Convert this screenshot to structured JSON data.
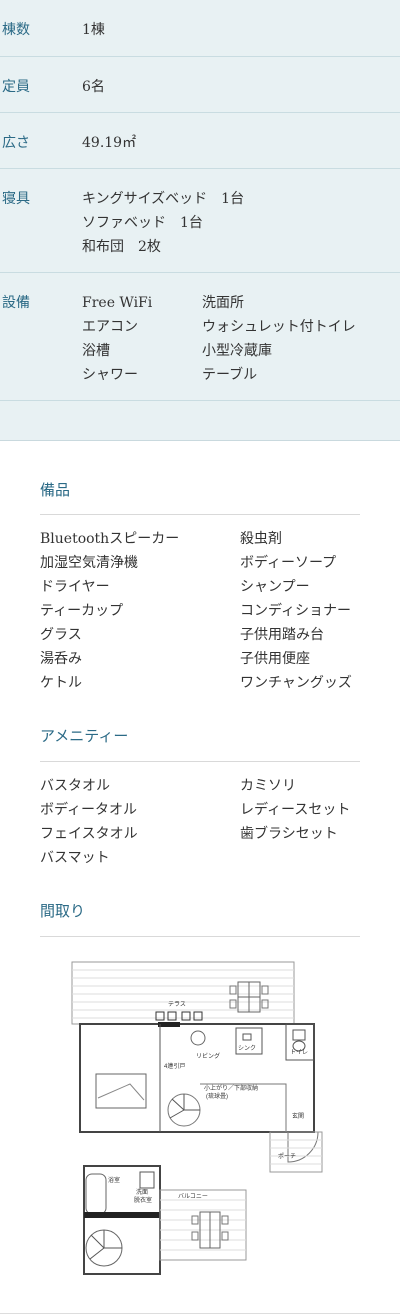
{
  "specs": {
    "buildings": {
      "label": "棟数",
      "value": "1棟"
    },
    "capacity": {
      "label": "定員",
      "value": "6名"
    },
    "area": {
      "label": "広さ",
      "value": "49.19㎡"
    },
    "bedding": {
      "label": "寝具",
      "lines": [
        "キングサイズベッド　1台",
        "ソファベッド　1台",
        "和布団　2枚"
      ]
    },
    "facilities": {
      "label": "設備",
      "col1": [
        "Free WiFi",
        "エアコン",
        "浴槽",
        "シャワー"
      ],
      "col2": [
        "洗面所",
        "ウォシュレット付トイレ",
        "小型冷蔵庫",
        "テーブル"
      ]
    }
  },
  "equipment": {
    "title": "備品",
    "col1": [
      "Bluetoothスピーカー",
      "加湿空気清浄機",
      "ドライヤー",
      "ティーカップ",
      "グラス",
      "湯呑み",
      "ケトル"
    ],
    "col2": [
      "殺虫剤",
      "ボディーソープ",
      "シャンプー",
      "コンディショナー",
      "子供用踏み台",
      "子供用便座",
      "ワンチャングッズ"
    ]
  },
  "amenity": {
    "title": "アメニティー",
    "col1": [
      "バスタオル",
      "ボディータオル",
      "フェイスタオル",
      "バスマット"
    ],
    "col2": [
      "カミソリ",
      "レディースセット",
      "歯ブラシセット"
    ]
  },
  "floorplan": {
    "title": "間取り",
    "labels": {
      "terrace": "テラス",
      "living": "リビング",
      "sink": "シンク",
      "toilet": "トイレ",
      "door": "4連引戸",
      "loft": "小上がり／下部収納",
      "loft2": "(琉球畳)",
      "entrance": "玄関",
      "porch": "ポーチ",
      "bath": "浴室",
      "washroom1": "洗面",
      "washroom2": "脱衣室",
      "balcony": "バルコニー"
    }
  }
}
